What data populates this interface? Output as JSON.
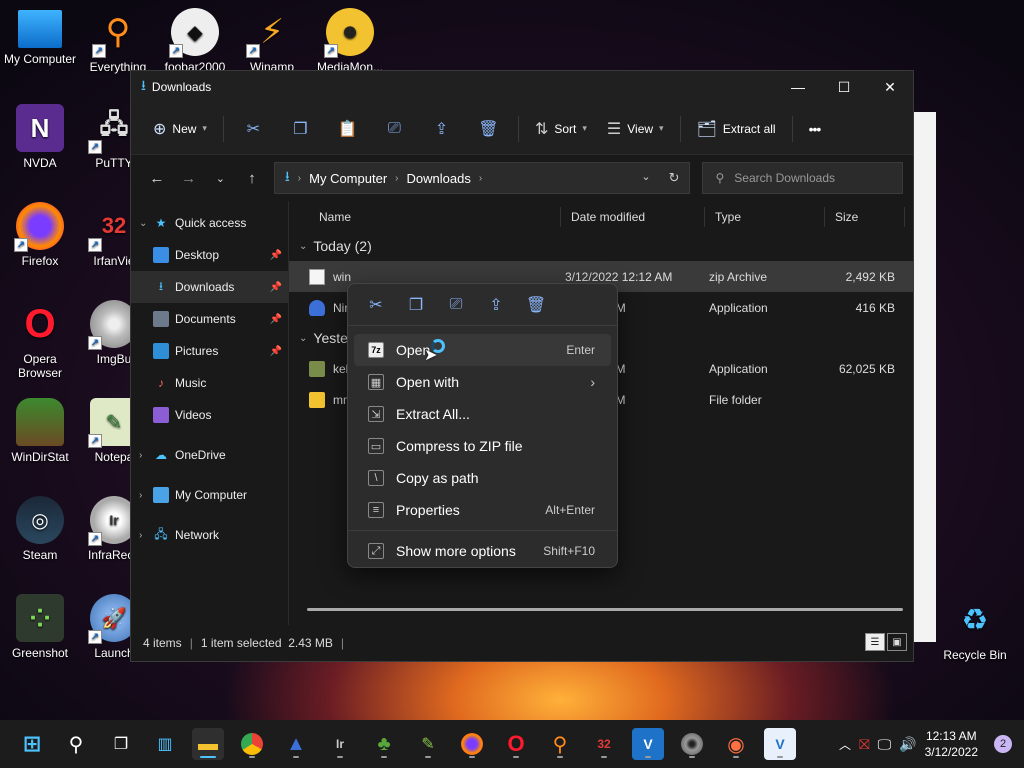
{
  "desktop": {
    "icons": [
      {
        "label": "My Computer"
      },
      {
        "label": "Everything"
      },
      {
        "label": "foobar2000"
      },
      {
        "label": "Winamp"
      },
      {
        "label": "MediaMon..."
      },
      {
        "label": "NVDA"
      },
      {
        "label": "PuTTY"
      },
      {
        "label": "Firefox"
      },
      {
        "label": "IrfanVie"
      },
      {
        "label": "Opera\nBrowser"
      },
      {
        "label": "ImgBu"
      },
      {
        "label": "WinDirStat"
      },
      {
        "label": "Notepa"
      },
      {
        "label": "Steam"
      },
      {
        "label": "InfraReco"
      },
      {
        "label": "Greenshot"
      },
      {
        "label": "Launch"
      },
      {
        "label": "Recycle Bin"
      }
    ]
  },
  "window": {
    "title": "Downloads",
    "minimize": "—",
    "maximize": "☐",
    "close": "✕"
  },
  "toolbar": {
    "new_label": "New",
    "sort_label": "Sort",
    "view_label": "View",
    "extract_all_label": "Extract all",
    "more_label": "•••"
  },
  "address": {
    "crumbs": [
      "My Computer",
      "Downloads"
    ],
    "search_placeholder": "Search Downloads"
  },
  "navpane": {
    "quick_access": "Quick access",
    "items": [
      {
        "label": "Desktop",
        "pinned": true
      },
      {
        "label": "Downloads",
        "pinned": true
      },
      {
        "label": "Documents",
        "pinned": true
      },
      {
        "label": "Pictures",
        "pinned": true
      },
      {
        "label": "Music"
      },
      {
        "label": "Videos"
      }
    ],
    "onedrive": "OneDrive",
    "my_computer": "My Computer",
    "network": "Network"
  },
  "columns": {
    "name": "Name",
    "date": "Date modified",
    "type": "Type",
    "size": "Size"
  },
  "groups": {
    "today": "Today (2)",
    "yesterday": "Yester"
  },
  "files": [
    {
      "name": "win",
      "date": "3/12/2022 12:12 AM",
      "type": "zip Archive",
      "size": "2,492 KB"
    },
    {
      "name": "Nin",
      "date": "2 12:07 AM",
      "type": "Application",
      "size": "416 KB"
    },
    {
      "name": "kek",
      "date": "2 11:51 PM",
      "type": "Application",
      "size": "62,025 KB"
    },
    {
      "name": "mm",
      "date": "2 11:52 PM",
      "type": "File folder",
      "size": ""
    }
  ],
  "status": {
    "count": "4 items",
    "selected": "1 item selected  2.43 MB"
  },
  "context_menu": {
    "items": [
      {
        "label": "Open",
        "shortcut": "Enter"
      },
      {
        "label": "Open with",
        "shortcut": "›"
      },
      {
        "label": "Extract All...",
        "shortcut": ""
      },
      {
        "label": "Compress to ZIP file",
        "shortcut": ""
      },
      {
        "label": "Copy as path",
        "shortcut": ""
      },
      {
        "label": "Properties",
        "shortcut": "Alt+Enter"
      },
      {
        "label": "Show more options",
        "shortcut": "Shift+F10"
      }
    ]
  },
  "taskbar": {
    "time": "12:13 AM",
    "date": "3/12/2022",
    "notifications": "2"
  }
}
